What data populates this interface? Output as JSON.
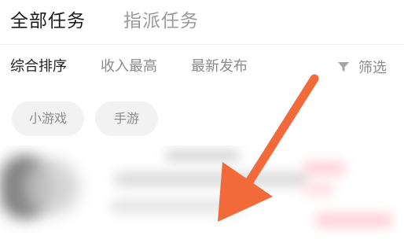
{
  "top_tabs": {
    "active": "全部任务",
    "inactive": "指派任务"
  },
  "sort_bar": {
    "items": [
      "综合排序",
      "收入最高",
      "最新发布"
    ],
    "filter_label": "筛选",
    "filter_icon": "filter-icon"
  },
  "chips": [
    "小游戏",
    "手游"
  ],
  "annotation": {
    "type": "arrow",
    "color": "#f26a3a"
  },
  "colors": {
    "active_text": "#1a1a1a",
    "inactive_text": "#8a8a8a",
    "chip_bg": "#f2f2f2"
  }
}
